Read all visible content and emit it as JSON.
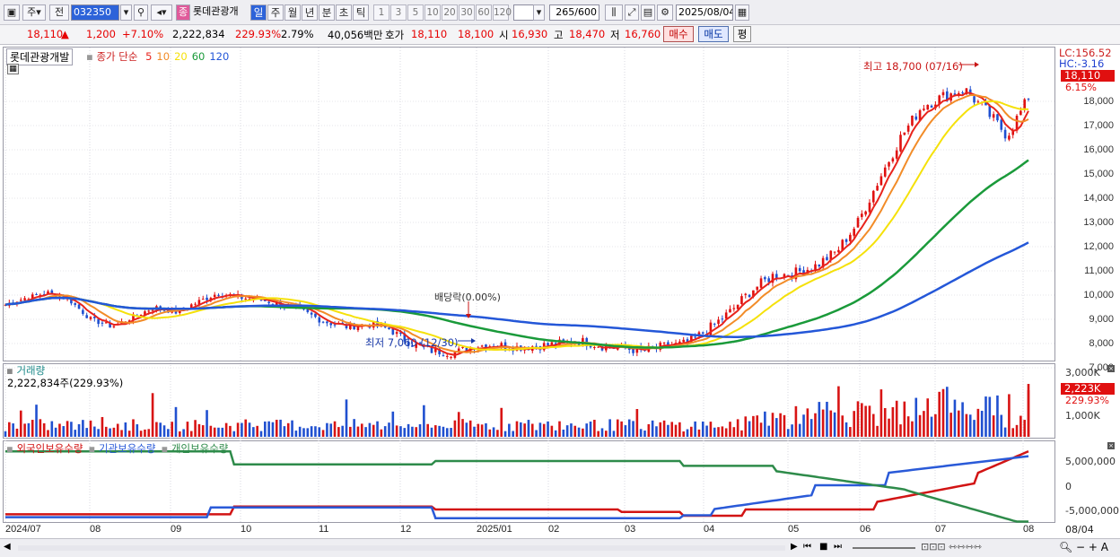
{
  "toolbar": {
    "market": "주",
    "prev": "전",
    "code": "032350",
    "name": "롯데관광개",
    "periods": [
      "일",
      "주",
      "월",
      "년",
      "분",
      "초",
      "틱"
    ],
    "intervals": [
      "1",
      "3",
      "5",
      "10",
      "20",
      "30",
      "60",
      "120"
    ],
    "count": "265",
    "count_max": "/600",
    "date": "2025/08/04"
  },
  "quote": {
    "price": "18,110",
    "arrow": "▲",
    "change": "1,200",
    "change_pct": "+7.10%",
    "volume": "2,222,834",
    "vol_ratio": "229.93%",
    "turnover": "2.79%",
    "amount": "40,056백만",
    "ask_label": "호가",
    "ask": "18,110",
    "bid": "18,100",
    "open_label": "시",
    "open": "16,930",
    "high_label": "고",
    "high": "18,470",
    "low_label": "저",
    "low": "16,760",
    "buy": "매수",
    "sell": "매도",
    "eval": "평"
  },
  "price_panel": {
    "stock_name": "롯데관광개발",
    "ma_label": "종가 단순",
    "ma_periods": [
      "5",
      "10",
      "20",
      "60",
      "120"
    ],
    "ma_colors": [
      "#e8231c",
      "#f28c28",
      "#f5e10a",
      "#1a9a3a",
      "#2457d8"
    ],
    "lc": "LC:156.52",
    "hc": "HC:-3.16",
    "last": "18,110",
    "last_pct": "6.15%",
    "high_note": "최고 18,700 (07/16)",
    "low_note": "최저 7,060 (12/30)",
    "event_note": "배당락(0.00%)",
    "y_ticks": [
      "18,000",
      "17,000",
      "16,000",
      "15,000",
      "14,000",
      "13,000",
      "12,000",
      "11,000",
      "10,000",
      "9,000",
      "8,000",
      "7,000"
    ]
  },
  "volume_panel": {
    "title": "거래량",
    "value": "2,222,834주(229.93%)",
    "y_ticks": [
      "3,000K",
      "1,000K"
    ],
    "last": "2,223K",
    "last_pct": "229.93%"
  },
  "holdings_panel": {
    "titles": [
      "외국인보유수량",
      "기관보유수량",
      "개인보유수량"
    ],
    "colors": [
      "#d21414",
      "#2a5ad8",
      "#2e8b4a"
    ],
    "y_ticks": [
      "5,000,000",
      "0",
      "-5,000,000"
    ]
  },
  "x_axis": {
    "labels": [
      "2024/07",
      "08",
      "09",
      "10",
      "11",
      "12",
      "2025/01",
      "02",
      "03",
      "04",
      "05",
      "06",
      "07",
      "08"
    ],
    "right_label": "08/04"
  },
  "chart_data": {
    "type": "candlestick",
    "x_labels": [
      "2024/07",
      "08",
      "09",
      "10",
      "11",
      "12",
      "2025/01",
      "02",
      "03",
      "04",
      "05",
      "06",
      "07",
      "08"
    ],
    "y_range": [
      6500,
      19500
    ],
    "close_path": [
      9600,
      9900,
      10100,
      9800,
      9000,
      8700,
      9100,
      9500,
      9300,
      9700,
      10100,
      9900,
      9800,
      9600,
      9300,
      8900,
      8700,
      8800,
      8600,
      8000,
      7700,
      7600,
      7900,
      7950,
      7850,
      7900,
      8000,
      8100,
      7900,
      7800,
      7700,
      7900,
      8000,
      8600,
      9300,
      10200,
      10800,
      10900,
      11200,
      11800,
      13000,
      14800,
      16500,
      17800,
      18200,
      18500,
      17600,
      16600,
      18110
    ],
    "annotations": [
      "최고 18,700 (07/16)",
      "최저 7,060 (12/30)"
    ]
  }
}
